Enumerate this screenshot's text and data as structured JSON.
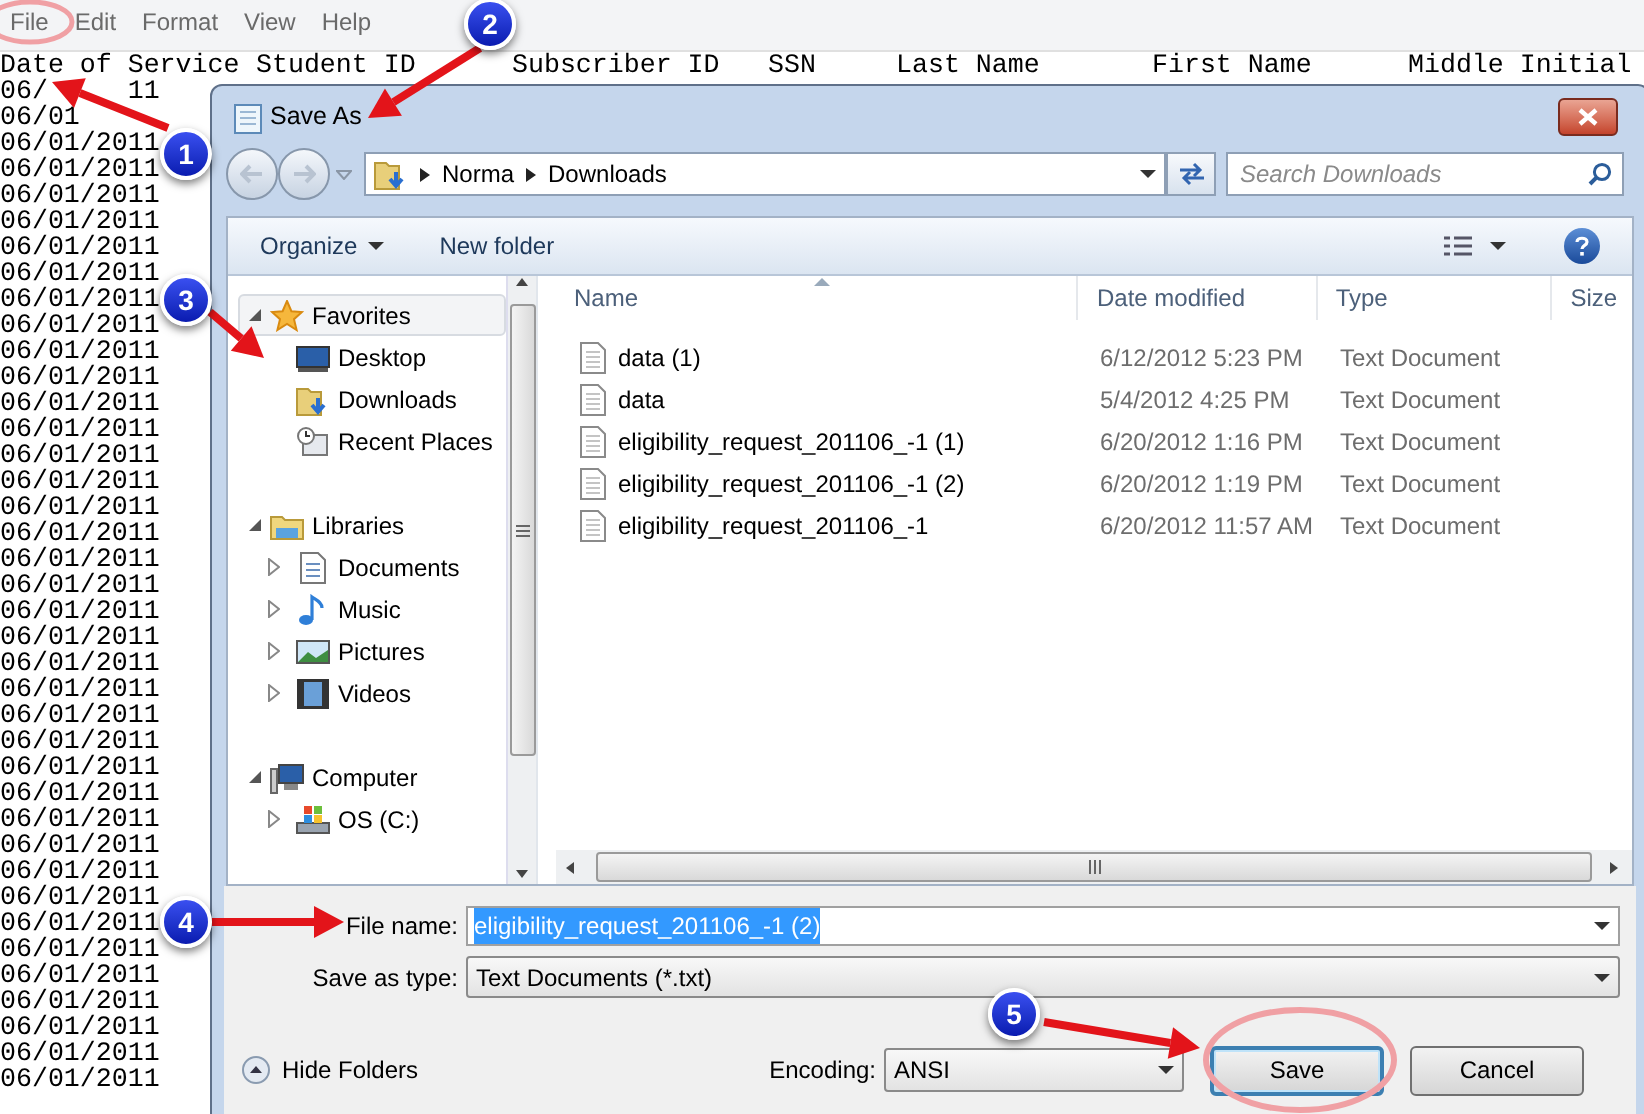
{
  "notepad": {
    "menu": [
      "File",
      "Edit",
      "Format",
      "View",
      "Help"
    ],
    "header": [
      "Date of Service",
      "Student ID",
      "Subscriber ID",
      "SSN",
      "Last Name",
      "First Name",
      "Middle Initial"
    ],
    "rows": [
      "06/     11",
      "06/01",
      "06/01/2011",
      "06/01/2011",
      "06/01/2011",
      "06/01/2011",
      "06/01/2011",
      "06/01/2011",
      "06/01/2011",
      "06/01/2011",
      "06/01/2011",
      "06/01/2011",
      "06/01/2011",
      "06/01/2011",
      "06/01/2011",
      "06/01/2011",
      "06/01/2011",
      "06/01/2011",
      "06/01/2011",
      "06/01/2011",
      "06/01/2011",
      "06/01/2011",
      "06/01/2011",
      "06/01/2011",
      "06/01/2011",
      "06/01/2011",
      "06/01/2011",
      "06/01/2011",
      "06/01/2011",
      "06/01/2011",
      "06/01/2011",
      "06/01/2011",
      "06/01/2011",
      "06/01/2011",
      "06/01/2011",
      "06/01/2011",
      "06/01/2011",
      "06/01/2011",
      "06/01/2011"
    ]
  },
  "dialog": {
    "title": "Save As",
    "breadcrumb": [
      "Norma",
      "Downloads"
    ],
    "search": {
      "placeholder": "Search Downloads"
    },
    "toolbar": [
      "Organize",
      "New folder"
    ],
    "nav": [
      {
        "label": "Favorites",
        "kind": "star",
        "expanded": true,
        "selected": true,
        "children": [
          {
            "label": "Desktop",
            "kind": "desktop"
          },
          {
            "label": "Downloads",
            "kind": "downloads"
          },
          {
            "label": "Recent Places",
            "kind": "recent"
          }
        ]
      },
      {
        "label": "Libraries",
        "kind": "library",
        "expanded": true,
        "selected": false,
        "children": [
          {
            "label": "Documents",
            "kind": "document",
            "expanded": false
          },
          {
            "label": "Music",
            "kind": "music",
            "expanded": false
          },
          {
            "label": "Pictures",
            "kind": "pictures",
            "expanded": false
          },
          {
            "label": "Videos",
            "kind": "videos",
            "expanded": false
          }
        ]
      },
      {
        "label": "Computer",
        "kind": "computer",
        "expanded": true,
        "selected": false,
        "children": [
          {
            "label": "OS (C:)",
            "kind": "drive",
            "expanded": false
          }
        ]
      }
    ],
    "columns": [
      "Name",
      "Date modified",
      "Type",
      "Size"
    ],
    "files": [
      {
        "name": "data (1)",
        "date": "6/12/2012 5:23 PM",
        "type": "Text Document"
      },
      {
        "name": "data",
        "date": "5/4/2012 4:25 PM",
        "type": "Text Document"
      },
      {
        "name": "eligibility_request_201106_-1 (1)",
        "date": "6/20/2012 1:16 PM",
        "type": "Text Document"
      },
      {
        "name": "eligibility_request_201106_-1 (2)",
        "date": "6/20/2012 1:19 PM",
        "type": "Text Document"
      },
      {
        "name": "eligibility_request_201106_-1",
        "date": "6/20/2012 11:57 AM",
        "type": "Text Document"
      }
    ],
    "file_name": {
      "label": "File name:",
      "value": "eligibility_request_201106_-1 (2)",
      "selected": true
    },
    "save_as_type": {
      "label": "Save as type:",
      "value": "Text Documents (*.txt)"
    },
    "hide_folders": "Hide Folders",
    "encoding": {
      "label": "Encoding:",
      "value": "ANSI"
    },
    "buttons": [
      {
        "label": "Save",
        "default": true
      },
      {
        "label": "Cancel",
        "default": false
      }
    ]
  },
  "annotations": [
    "1",
    "2",
    "3",
    "4",
    "5"
  ]
}
